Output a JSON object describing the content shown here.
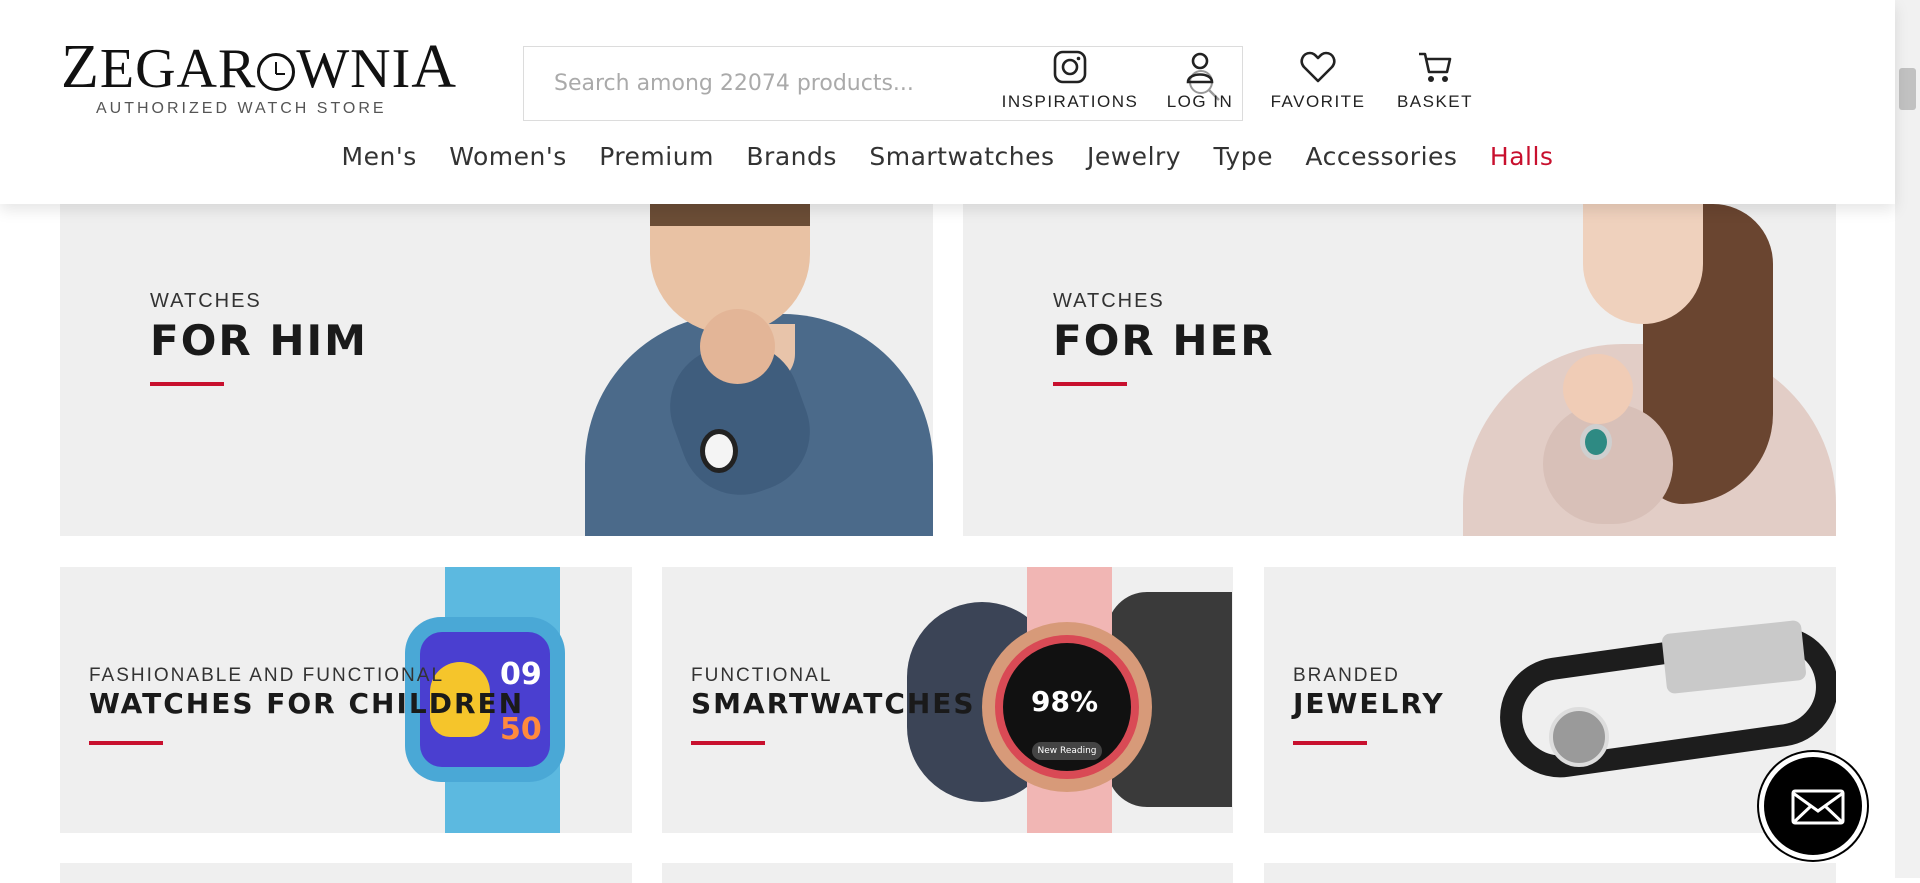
{
  "logo": {
    "word_prefix": "Z",
    "word_mid": "EGAR",
    "word_suffix": "WNI",
    "word_end": "A",
    "subtitle": "AUTHORIZED WATCH STORE"
  },
  "search": {
    "placeholder": "Search among 22074 products..."
  },
  "header_icons": [
    {
      "icon": "instagram-icon",
      "label": "INSPIRATIONS"
    },
    {
      "icon": "user-icon",
      "label": "LOG IN"
    },
    {
      "icon": "heart-icon",
      "label": "FAVORITE"
    },
    {
      "icon": "cart-icon",
      "label": "BASKET"
    }
  ],
  "nav": [
    "Men's",
    "Women's",
    "Premium",
    "Brands",
    "Smartwatches",
    "Jewelry",
    "Type",
    "Accessories",
    "Halls"
  ],
  "tiles": {
    "him": {
      "kicker": "WATCHES",
      "headline": "FOR HIM"
    },
    "her": {
      "kicker": "WATCHES",
      "headline": "FOR HER"
    },
    "kids": {
      "kicker": "FASHIONABLE AND FUNCTIONAL",
      "headline": "WATCHES FOR CHILDREN",
      "screen_time": "09",
      "screen_num": "50"
    },
    "smart": {
      "kicker": "FUNCTIONAL",
      "headline": "SMARTWATCHES",
      "screen_pct": "98%",
      "screen_btn": "New Reading"
    },
    "jewelry": {
      "kicker": "BRANDED",
      "headline": "JEWELRY"
    }
  },
  "colors": {
    "accent": "#c8102e",
    "tile_bg": "#efefef"
  }
}
